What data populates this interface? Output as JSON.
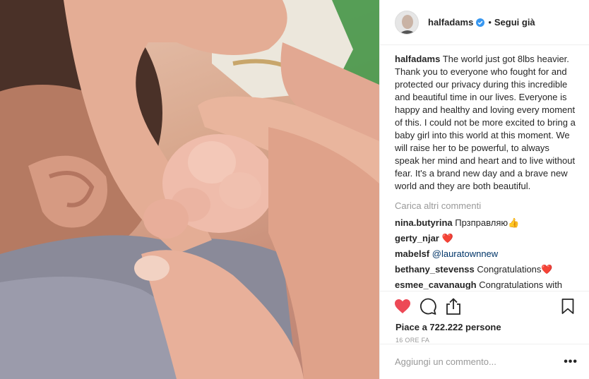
{
  "header": {
    "username": "halfadams",
    "separator": "•",
    "follow_status": "Segui già"
  },
  "caption": {
    "username": "halfadams",
    "text": "The world just got 8lbs heavier. Thank you to everyone who fought for and protected our privacy during this incredible and beautiful time in our lives. Everyone is happy and healthy and loving every moment of this. I could not be more excited to bring a baby girl into this world at this moment. We will raise her to be powerful, to always speak her mind and heart and to live without fear. It's a brand new day and a brave new world and they are both beautiful."
  },
  "load_more": "Carica altri commenti",
  "comments": [
    {
      "user": "nina.butyrina",
      "text": "Прзправляю👍"
    },
    {
      "user": "gerty_njar",
      "text": "❤️"
    },
    {
      "user": "mabelsf",
      "mention": "@lauratownnew"
    },
    {
      "user": "bethany_stevenss",
      "text": "Congratulations❤️"
    },
    {
      "user": "esmee_cavanaugh",
      "text": "Congratulations with this angel🖤"
    }
  ],
  "likes": "Piace a 722.222 persone",
  "timestamp": "16 ORE FA",
  "add_comment": {
    "placeholder": "Aggiungi un commento..."
  },
  "more_label": "•••",
  "icons": {
    "like": "heart-icon",
    "comment": "comment-icon",
    "share": "share-icon",
    "save": "bookmark-icon",
    "verified": "verified-badge-icon"
  },
  "colors": {
    "like_active": "#ed4956",
    "verified": "#3897f0",
    "mention": "#003569"
  }
}
